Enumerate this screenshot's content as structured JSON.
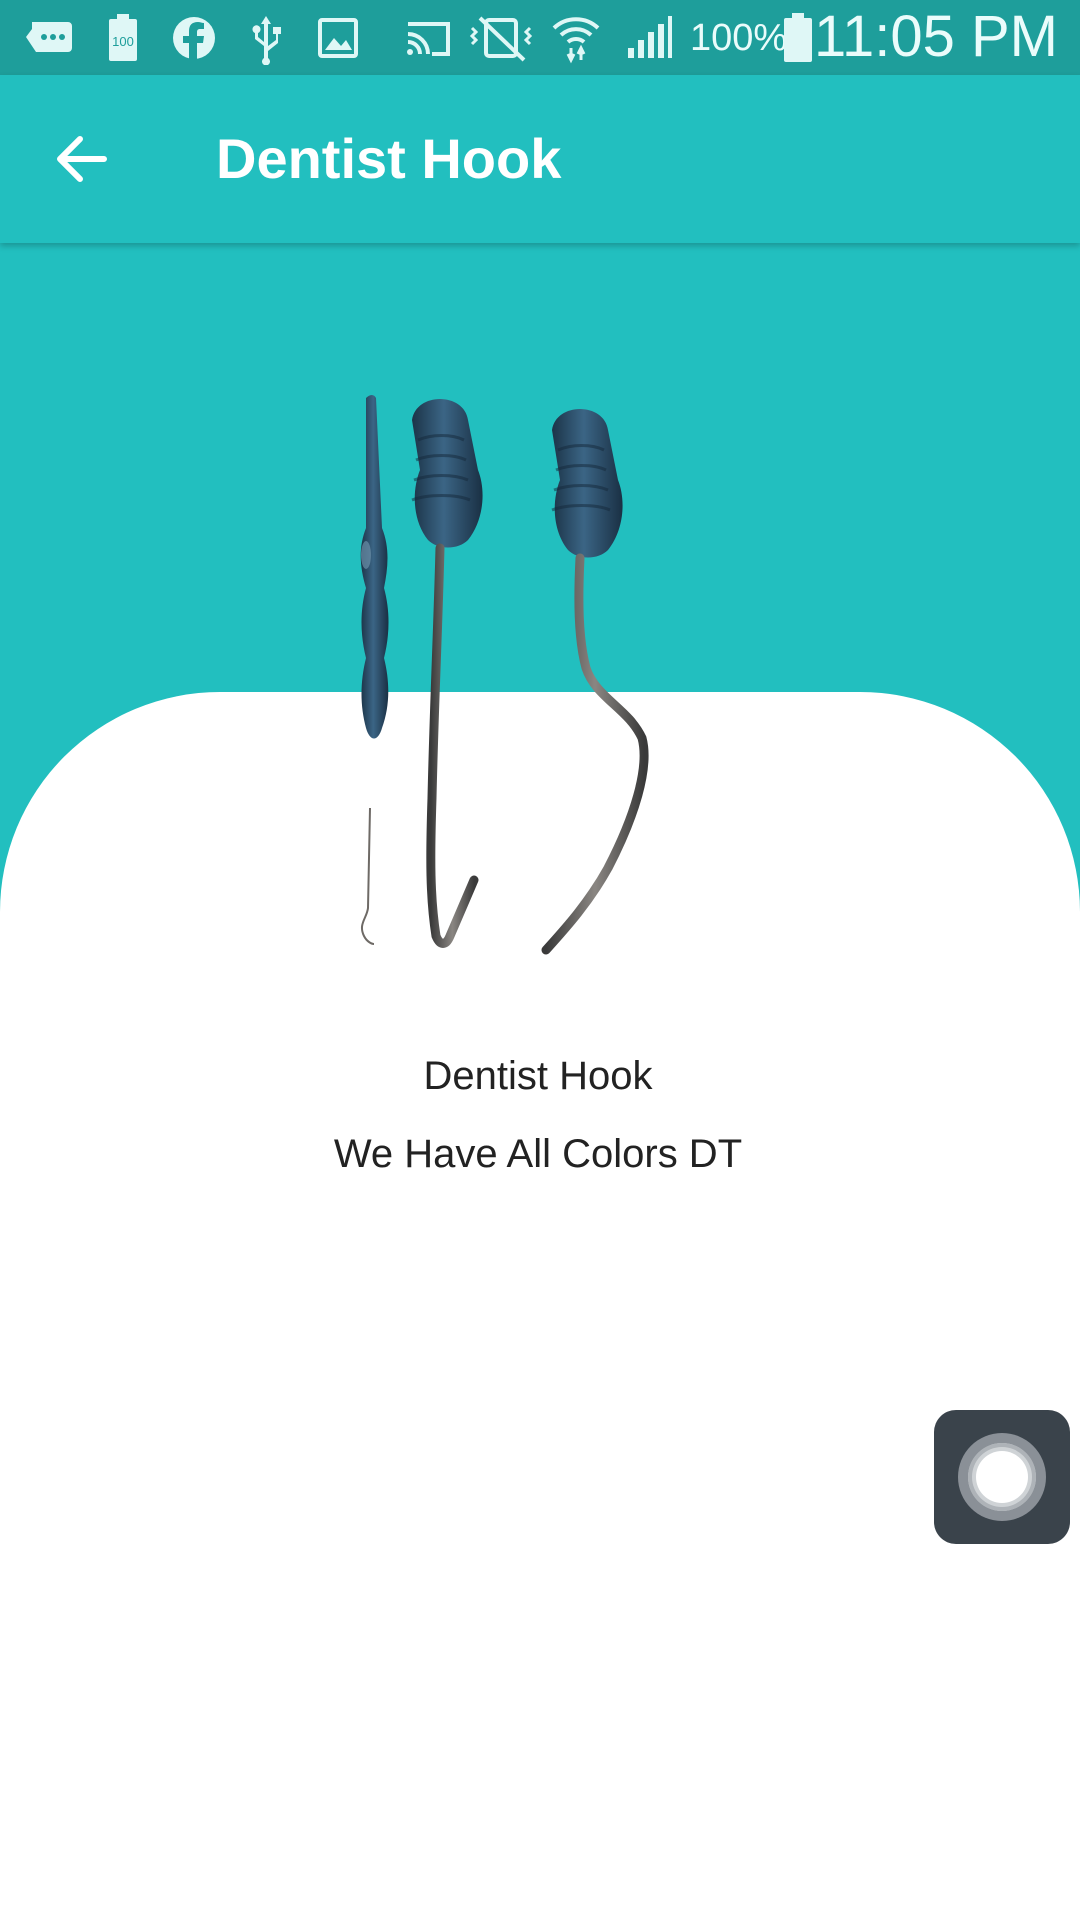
{
  "status_bar": {
    "battery_percent": "100%",
    "time": "11:05 PM",
    "icons": [
      "message-icon",
      "battery-100-icon",
      "facebook-icon",
      "usb-icon",
      "image-icon",
      "cast-icon",
      "vibrate-off-icon",
      "wifi-icon",
      "signal-icon",
      "battery-icon"
    ]
  },
  "app_bar": {
    "title": "Dentist Hook",
    "back_icon": "arrow-back-icon",
    "color": "#22bfbf"
  },
  "product": {
    "name": "Dentist Hook",
    "description": "We Have All Colors DT",
    "image": "dentist-hook-tools-image"
  },
  "floating_button": {
    "icon": "assistive-touch-icon"
  },
  "colors": {
    "status_bar": "#1e9e9b",
    "accent": "#22bfbf",
    "background": "#ffffff",
    "text": "#222222"
  }
}
